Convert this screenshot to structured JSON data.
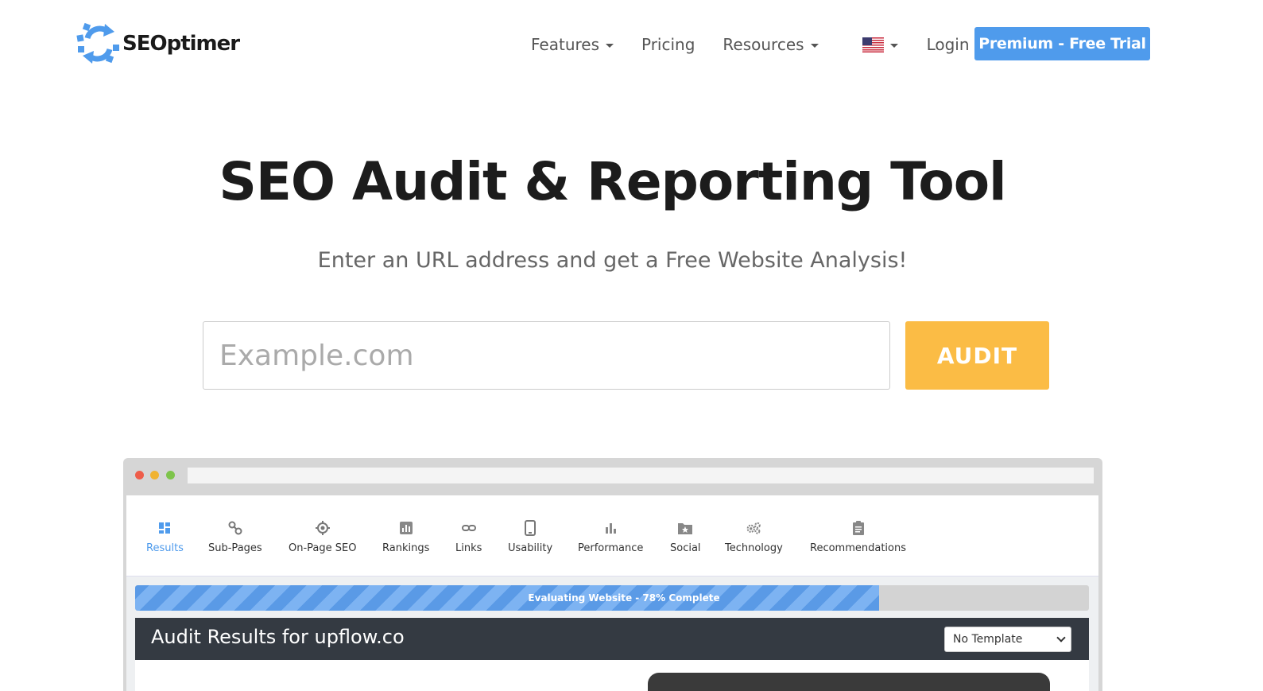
{
  "brand": {
    "name": "SEOptimer",
    "color": "#4f9bec"
  },
  "nav": {
    "features": "Features",
    "pricing": "Pricing",
    "resources": "Resources",
    "login": "Login",
    "cta": "Premium - Free Trial"
  },
  "hero": {
    "title": "SEO Audit & Reporting Tool",
    "subtitle": "Enter an URL address and get a Free Website Analysis!",
    "placeholder": "Example.com",
    "button": "AUDIT"
  },
  "mockup": {
    "tabs": [
      {
        "label": "Results",
        "icon": "grid-icon",
        "active": true
      },
      {
        "label": "Sub-Pages",
        "icon": "link-nodes-icon"
      },
      {
        "label": "On-Page SEO",
        "icon": "target-icon"
      },
      {
        "label": "Rankings",
        "icon": "bar-chart-icon"
      },
      {
        "label": "Links",
        "icon": "chain-link-icon"
      },
      {
        "label": "Usability",
        "icon": "mobile-icon"
      },
      {
        "label": "Performance",
        "icon": "stats-icon"
      },
      {
        "label": "Social",
        "icon": "star-folder-icon"
      },
      {
        "label": "Technology",
        "icon": "gears-icon"
      },
      {
        "label": "Recommendations",
        "icon": "clipboard-icon"
      }
    ],
    "progress": {
      "text": "Evaluating Website - 78% Complete",
      "percent": 78
    },
    "results_title": "Audit Results for upflow.co",
    "template_select": "No Template"
  }
}
